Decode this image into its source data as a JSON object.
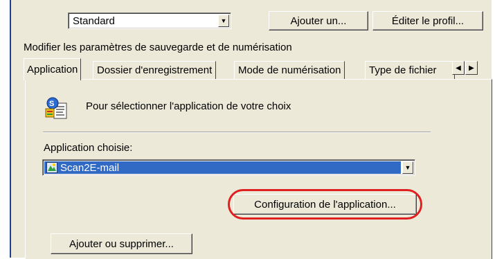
{
  "profile": {
    "selected": "Standard",
    "add_button": "Ajouter un...",
    "edit_button": "Éditer le profil..."
  },
  "section_label": "Modifier les paramètres de sauvegarde et de numérisation",
  "tabs": [
    {
      "label": "Application",
      "active": true
    },
    {
      "label": "Dossier d'enregistrement",
      "active": false
    },
    {
      "label": "Mode de numérisation",
      "active": false
    },
    {
      "label": "Type de fichier",
      "active": false
    }
  ],
  "panel": {
    "description": "Pour sélectionner l'application de votre choix",
    "chosen_label": "Application choisie:",
    "chosen_app": "Scan2E-mail",
    "config_button": "Configuration de l'application...",
    "add_remove_button": "Ajouter ou supprimer..."
  },
  "icons": {
    "app_settings": "application-settings-icon",
    "app_item": "scan2email-icon",
    "dropdown": "chevron-down-icon",
    "tab_left": "arrow-left-icon",
    "tab_right": "arrow-right-icon"
  },
  "colors": {
    "highlight": "#316ac5",
    "callout": "#e02020",
    "window_bg": "#ece9d8"
  }
}
